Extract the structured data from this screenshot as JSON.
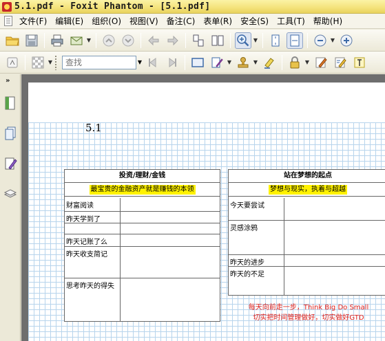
{
  "window": {
    "title": "5.1.pdf - Foxit Phantom - [5.1.pdf]"
  },
  "menu": [
    {
      "label": "文件(F)"
    },
    {
      "label": "编辑(E)"
    },
    {
      "label": "组织(O)"
    },
    {
      "label": "视图(V)"
    },
    {
      "label": "备注(C)"
    },
    {
      "label": "表单(R)"
    },
    {
      "label": "安全(S)"
    },
    {
      "label": "工具(T)"
    },
    {
      "label": "帮助(H)"
    }
  ],
  "toolbar": {
    "search": {
      "placeholder": "查找"
    }
  },
  "document": {
    "page_title": "5.1",
    "left_box": {
      "heading": "投资/理财/金钱",
      "subtitle": "最宝贵的金融资产就是赚钱的本领",
      "rows": [
        {
          "label": "财富阅读"
        },
        {
          "label": "昨天学到了"
        },
        {
          "label": "昨天记账了么"
        },
        {
          "label": "昨天收支简记"
        },
        {
          "label": "思考昨天的得失"
        }
      ]
    },
    "right_box": {
      "heading": "站在梦想的起点",
      "subtitle": "梦想与现实，执着与超越",
      "rows": [
        {
          "label": "今天要尝试"
        },
        {
          "label": "灵感涂鸦"
        },
        {
          "label": "昨天的进步"
        },
        {
          "label": "昨天的不足"
        }
      ]
    },
    "note": {
      "line1": "每天向前走一步，Think Big Do Small",
      "line2": "切实把时间管理做好，切实做好GTD"
    }
  },
  "colors": {
    "highlight": "#fff200",
    "note_text": "#e0201a",
    "grid_line": "#b7d4ec"
  }
}
